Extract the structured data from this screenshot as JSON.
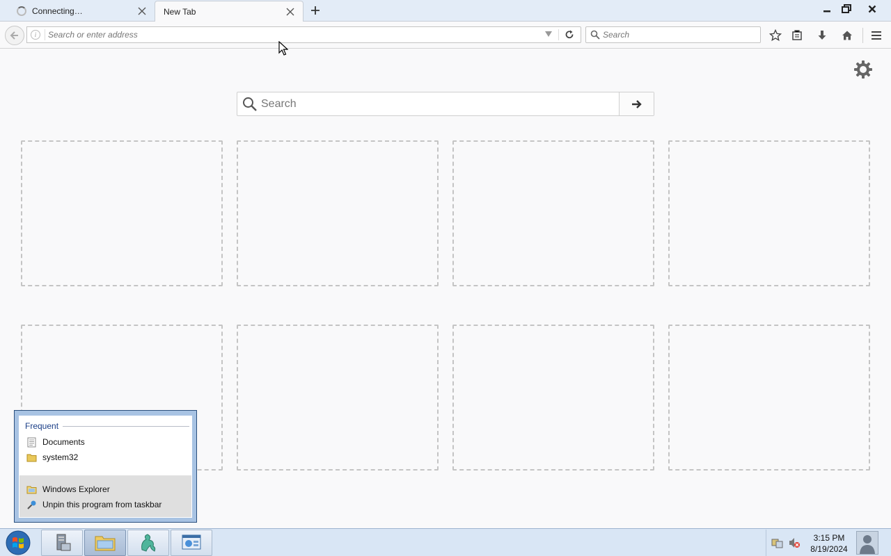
{
  "tabs": [
    {
      "label": "Connecting…",
      "state": "loading"
    },
    {
      "label": "New Tab",
      "state": "active"
    }
  ],
  "navbar": {
    "url_placeholder": "Search or enter address",
    "search_placeholder": "Search"
  },
  "newtab": {
    "search_placeholder": "Search",
    "tile_count": 8
  },
  "jumplist": {
    "heading": "Frequent",
    "frequent_items": [
      {
        "label": "Documents",
        "icon": "document-icon"
      },
      {
        "label": "system32",
        "icon": "folder-icon"
      }
    ],
    "tasks": [
      {
        "label": "Windows Explorer",
        "icon": "explorer-icon"
      },
      {
        "label": "Unpin this program from taskbar",
        "icon": "unpin-icon"
      }
    ]
  },
  "taskbar": {
    "time": "3:15 PM",
    "date": "8/19/2024"
  },
  "colors": {
    "tabstrip": "#e3ecf7",
    "page_bg": "#f9f9fa",
    "taskbar": "#d9e6f5",
    "jumplist_heading": "#1a3e87"
  }
}
